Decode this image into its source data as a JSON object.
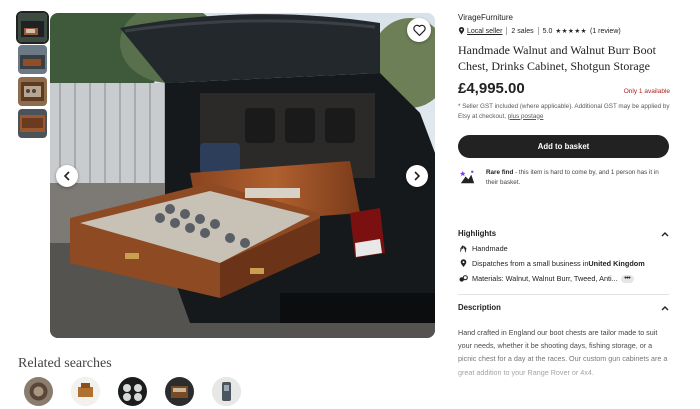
{
  "gallery": {
    "thumbnail_count": 4,
    "favorite_icon": "heart-outline-icon",
    "prev_icon": "chevron-left-icon",
    "next_icon": "chevron-right-icon"
  },
  "related": {
    "title": "Related searches",
    "item_count": 5
  },
  "shop": {
    "name": "VirageFurniture",
    "local_seller": "Local seller",
    "sales": "2 sales",
    "rating": "5.0",
    "stars": "★★★★★",
    "reviews": "(1 review)"
  },
  "product": {
    "title": "Handmade Walnut and Walnut Burr Boot Chest, Drinks Cabinet, Shotgun Storage",
    "price": "£4,995.00",
    "stock": "Only 1 available",
    "gst_note": "* Seller GST included (where applicable). Additional GST may be applied by Etsy at checkout,",
    "gst_link": "plus postage",
    "add_to_basket": "Add to basket"
  },
  "rare_find": {
    "label": "Rare find",
    "text": " - this item is hard to come by, and 1 person has it in their basket."
  },
  "highlights": {
    "title": "Highlights",
    "items": [
      {
        "icon": "hand-icon",
        "text": "Handmade",
        "bold": ""
      },
      {
        "icon": "location-pin-icon",
        "text": "Dispatches from a small business in ",
        "bold": "United Kingdom"
      },
      {
        "icon": "materials-icon",
        "text": "Materials: Walnut, Walnut Burr, Tweed, Anti...",
        "bold": ""
      }
    ]
  },
  "description": {
    "title": "Description",
    "text": "Hand crafted in England our boot chests are tailor made to suit your needs, whether it be shooting days, fishing storage, or a picnic chest for a day at the races. Our custom gun cabinets are a great addition to your Range Rover or 4x4."
  },
  "colors": {
    "primary_button": "#222222",
    "stock_red": "#b3211e",
    "walnut": "#a0522d"
  }
}
